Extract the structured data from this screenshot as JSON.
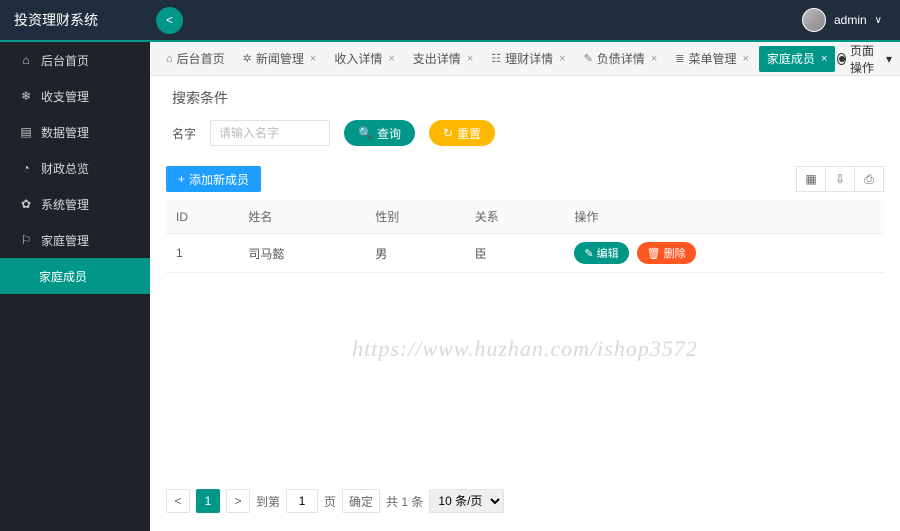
{
  "app": {
    "title": "投资理财系统"
  },
  "user": {
    "name": "admin"
  },
  "sidebar": {
    "items": [
      {
        "label": "后台首页",
        "icon": "⌂"
      },
      {
        "label": "收支管理",
        "icon": "❄"
      },
      {
        "label": "数据管理",
        "icon": "▤"
      },
      {
        "label": "财政总览",
        "icon": "◔"
      },
      {
        "label": "系统管理",
        "icon": "✿"
      },
      {
        "label": "家庭管理",
        "icon": "⚐"
      },
      {
        "label": "家庭成员",
        "icon": ""
      }
    ]
  },
  "tabs": [
    {
      "label": "后台首页",
      "icon": "⌂",
      "closable": false
    },
    {
      "label": "新闻管理",
      "icon": "✲",
      "closable": true
    },
    {
      "label": "收入详情",
      "icon": "",
      "closable": true
    },
    {
      "label": "支出详情",
      "icon": "",
      "closable": true
    },
    {
      "label": "理财详情",
      "icon": "☷",
      "closable": true
    },
    {
      "label": "负债详情",
      "icon": "✎",
      "closable": true
    },
    {
      "label": "菜单管理",
      "icon": "≣",
      "closable": true
    },
    {
      "label": "家庭成员",
      "icon": "",
      "closable": true,
      "active": true
    }
  ],
  "pageOp": {
    "label": "页面操作"
  },
  "search": {
    "title": "搜索条件",
    "nameLabel": "名字",
    "namePlaceholder": "请输入名字",
    "queryLabel": "查询",
    "resetLabel": "重置"
  },
  "toolbar": {
    "addLabel": "添加新成员"
  },
  "table": {
    "headers": [
      "ID",
      "姓名",
      "性别",
      "关系",
      "操作"
    ],
    "rows": [
      {
        "id": "1",
        "name": "司马懿",
        "gender": "男",
        "relation": "臣"
      }
    ],
    "editLabel": "编辑",
    "deleteLabel": "删除"
  },
  "pager": {
    "toLabel": "到第",
    "pageLabel": "页",
    "confirmLabel": "确定",
    "totalLabel": "共 1 条",
    "perPage": "10 条/页",
    "current": "1"
  },
  "watermark": "https://www.huzhan.com/ishop3572"
}
